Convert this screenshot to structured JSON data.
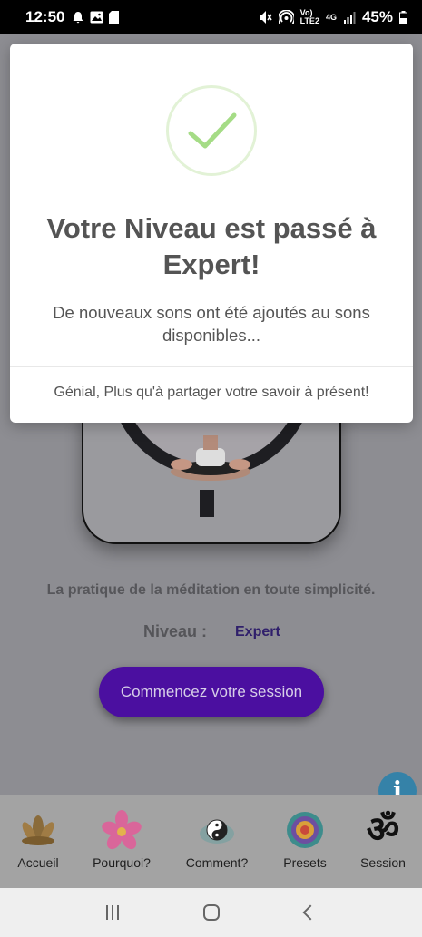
{
  "status_bar": {
    "time": "12:50",
    "network_small": "Vo)\nLTE2",
    "network_4g": "4G",
    "battery": "45%"
  },
  "main": {
    "tagline": "La pratique de la méditation en toute simplicité.",
    "level_label": "Niveau :",
    "level_value": "Expert",
    "start_button": "Commencez votre session",
    "info_icon": "i"
  },
  "tabs": [
    {
      "label": "Accueil",
      "icon": "lotus-icon"
    },
    {
      "label": "Pourquoi?",
      "icon": "pink-flower-icon"
    },
    {
      "label": "Comment?",
      "icon": "yin-yang-icon"
    },
    {
      "label": "Presets",
      "icon": "mandala-icon"
    },
    {
      "label": "Session",
      "icon": "om-icon"
    }
  ],
  "om_symbol": "ॐ",
  "modal": {
    "title": "Votre Niveau est passé à Expert!",
    "text": "De nouveaux sons ont été ajoutés au sons disponibles...",
    "footer": "Génial, Plus qu'à partager votre savoir à présent!"
  },
  "colors": {
    "accent_purple": "#4b0fa0",
    "check_green": "#a5dc86",
    "info_blue": "#3582a8"
  }
}
